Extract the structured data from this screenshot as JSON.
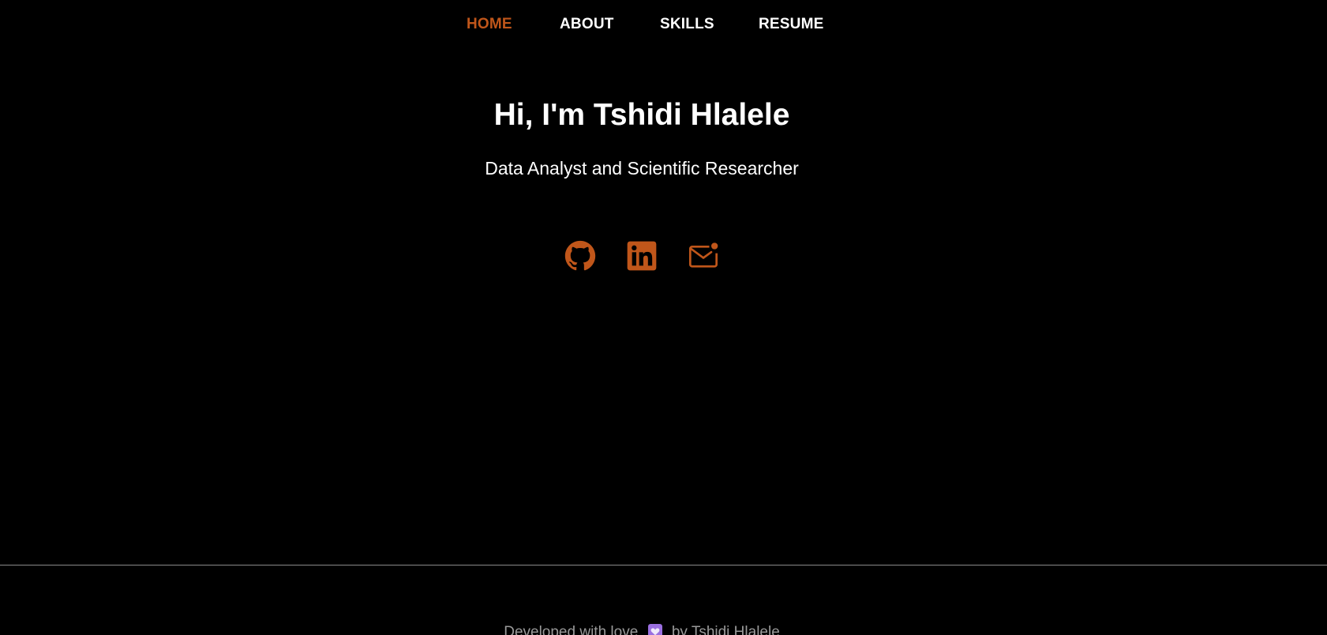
{
  "nav": {
    "items": [
      {
        "label": "HOME",
        "active": true
      },
      {
        "label": "ABOUT",
        "active": false
      },
      {
        "label": "SKILLS",
        "active": false
      },
      {
        "label": "RESUME",
        "active": false
      }
    ]
  },
  "hero": {
    "title": "Hi, I'm Tshidi Hlalele",
    "subtitle": "Data Analyst and Scientific Researcher"
  },
  "social": [
    {
      "icon": "github-icon"
    },
    {
      "icon": "linkedin-icon"
    },
    {
      "icon": "mail-notification-icon"
    }
  ],
  "footer": {
    "text_before": "Developed with love",
    "text_after": "by Tshidi Hlalele",
    "heart_icon": "purple-heart-icon"
  },
  "colors": {
    "background": "#000000",
    "accent": "#c0561a",
    "text": "#ffffff",
    "footer_text": "#9a9a9a",
    "heart": "#9b6fe0"
  }
}
